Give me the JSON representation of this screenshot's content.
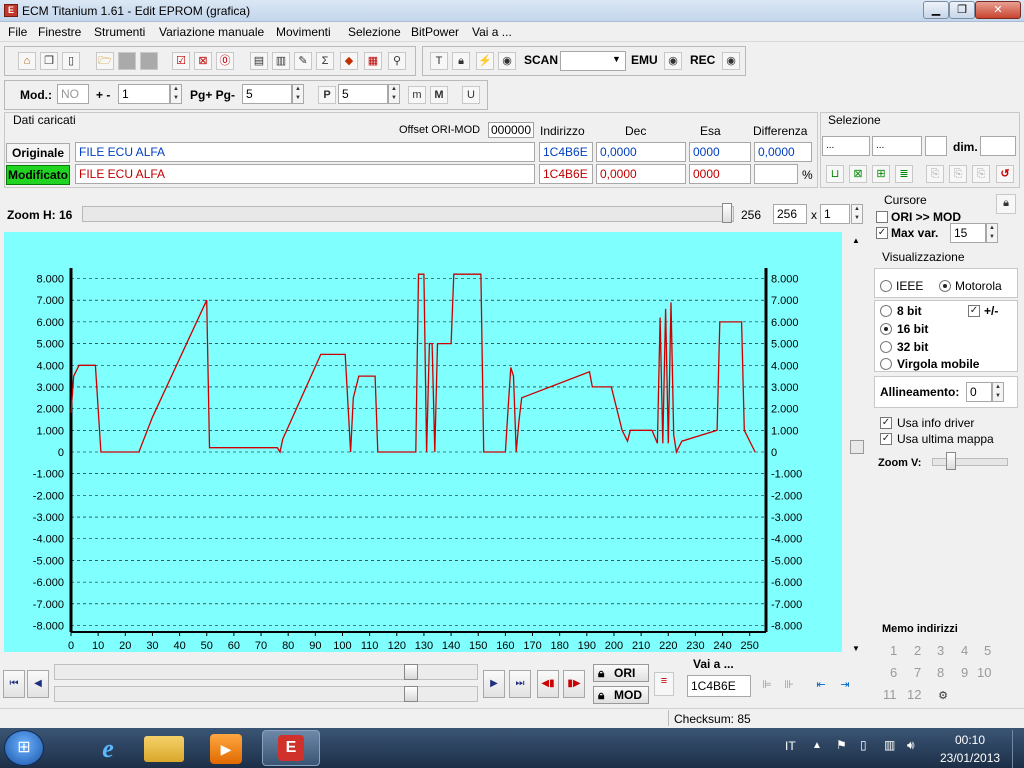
{
  "window": {
    "title": "ECM Titanium 1.61 - Edit EPROM (grafica)",
    "app_icon": "ecm-app-icon"
  },
  "menu": [
    "File",
    "Finestre",
    "Strumenti",
    "Variazione manuale",
    "Movimenti",
    "Selezione",
    "BitPower",
    "Vai a ..."
  ],
  "toolbar1": {
    "scan_label": "SCAN",
    "emu_label": "EMU",
    "rec_label": "REC"
  },
  "toolbar2": {
    "mod_label": "Mod.:",
    "mod_value": "NO",
    "plusminus_label": "+ -",
    "plusminus_value": "1",
    "pg_label": "Pg+ Pg-",
    "pg_value": "5",
    "p_value": "5"
  },
  "dati": {
    "title": "Dati caricati",
    "offset_label": "Offset ORI-MOD",
    "offset_value": "000000",
    "col_indirizzo": "Indirizzo",
    "col_dec": "Dec",
    "col_esa": "Esa",
    "col_diff": "Differenza",
    "originale": {
      "label": "Originale",
      "file": "FILE ECU ALFA",
      "indirizzo": "1C4B6E",
      "dec": "0,0000",
      "esa": "0000",
      "diff": "0,0000"
    },
    "modificato": {
      "label": "Modificato",
      "file": "FILE ECU ALFA",
      "indirizzo": "1C4B6E",
      "dec": "0,0000",
      "esa": "0000",
      "diff": "",
      "diff_unit": "%"
    }
  },
  "selezione": {
    "title": "Selezione",
    "field1": "...",
    "field2": "...",
    "dim_label": "dim."
  },
  "zoom": {
    "label": "Zoom H: 16",
    "value_text": "256",
    "field_value": "256",
    "x_label": "x",
    "mult": "1"
  },
  "cursore": {
    "title": "Cursore",
    "ori_mod_label": "ORI >> MOD",
    "ori_mod_checked": false,
    "maxvar_label": "Max var.",
    "maxvar_checked": true,
    "maxvar_value": "15"
  },
  "visualizzazione": {
    "title": "Visualizzazione",
    "ieee": "IEEE",
    "motorola": "Motorola",
    "endian_selected": "Motorola",
    "bits": [
      "8 bit",
      "16 bit",
      "32 bit",
      "Virgola mobile"
    ],
    "bits_selected": "16 bit",
    "signed_label": "+/-",
    "signed_checked": true,
    "allineamento_label": "Allineamento:",
    "allineamento_value": "0",
    "usa_info_driver": "Usa info driver",
    "usa_ultima_mappa": "Usa ultima mappa",
    "zoomv_label": "Zoom V:"
  },
  "memo": {
    "title": "Memo indirizzi",
    "items": [
      "1",
      "2",
      "3",
      "4",
      "5",
      "6",
      "7",
      "8",
      "9",
      "10",
      "11",
      "12"
    ]
  },
  "bottom": {
    "ori_label": "ORI",
    "mod_label": "MOD",
    "vai_label": "Vai a ...",
    "vai_value": "1C4B6E"
  },
  "status": {
    "checksum": "Checksum: 85"
  },
  "taskbar": {
    "lang": "IT",
    "time": "00:10",
    "date": "23/01/2013"
  },
  "chart_data": {
    "type": "line",
    "background": "#80ffff",
    "line_color": "#cc0000",
    "xlim": [
      0,
      256
    ],
    "ylim": [
      -8.3,
      8.3
    ],
    "x_ticks": [
      0,
      10,
      20,
      30,
      40,
      50,
      60,
      70,
      80,
      90,
      100,
      110,
      120,
      130,
      140,
      150,
      160,
      170,
      180,
      190,
      200,
      210,
      220,
      230,
      240,
      250
    ],
    "y_ticks": [
      "8.000",
      "7.000",
      "6.000",
      "5.000",
      "4.000",
      "3.000",
      "2.000",
      "1.000",
      "0",
      "-1.000",
      "-2.000",
      "-3.000",
      "-4.000",
      "-5.000",
      "-6.000",
      "-7.000",
      "-8.000"
    ],
    "grid": true,
    "series": [
      {
        "points": [
          [
            0,
            1.8
          ],
          [
            1,
            3.5
          ],
          [
            3,
            4
          ],
          [
            9,
            4
          ],
          [
            11,
            0
          ],
          [
            25,
            0
          ],
          [
            30,
            1.6
          ],
          [
            50,
            7
          ],
          [
            51,
            0.2
          ],
          [
            76,
            0.2
          ],
          [
            77,
            0
          ],
          [
            78,
            0.6
          ],
          [
            92,
            4.5
          ],
          [
            101,
            4.5
          ],
          [
            103,
            0
          ],
          [
            104,
            2.5
          ],
          [
            105,
            3
          ],
          [
            106,
            3.5
          ],
          [
            112,
            3.5
          ],
          [
            113,
            0
          ],
          [
            127,
            0
          ],
          [
            128,
            8.2
          ],
          [
            130,
            8.2
          ],
          [
            131,
            0
          ],
          [
            132,
            5
          ],
          [
            133,
            5
          ],
          [
            134,
            0
          ],
          [
            135,
            5
          ],
          [
            140,
            5
          ],
          [
            141,
            8.2
          ],
          [
            151,
            8.2
          ],
          [
            152,
            0
          ],
          [
            160,
            0
          ],
          [
            161,
            2
          ],
          [
            162,
            3.9
          ],
          [
            163,
            3.5
          ],
          [
            164,
            0
          ],
          [
            165,
            1.4
          ],
          [
            166,
            2.5
          ],
          [
            191,
            3.7
          ],
          [
            192,
            3
          ],
          [
            199,
            3
          ],
          [
            203,
            1
          ],
          [
            205,
            0.5
          ],
          [
            206,
            1
          ],
          [
            214,
            1
          ],
          [
            216,
            0.4
          ],
          [
            217,
            6.2
          ],
          [
            218,
            0.4
          ],
          [
            219,
            6.6
          ],
          [
            220,
            0.4
          ],
          [
            221,
            6.9
          ],
          [
            222,
            0.8
          ],
          [
            223,
            0
          ],
          [
            225,
            0.5
          ],
          [
            238,
            1
          ],
          [
            239,
            6
          ],
          [
            247,
            6
          ],
          [
            248,
            1
          ],
          [
            252,
            0
          ]
        ]
      }
    ]
  }
}
